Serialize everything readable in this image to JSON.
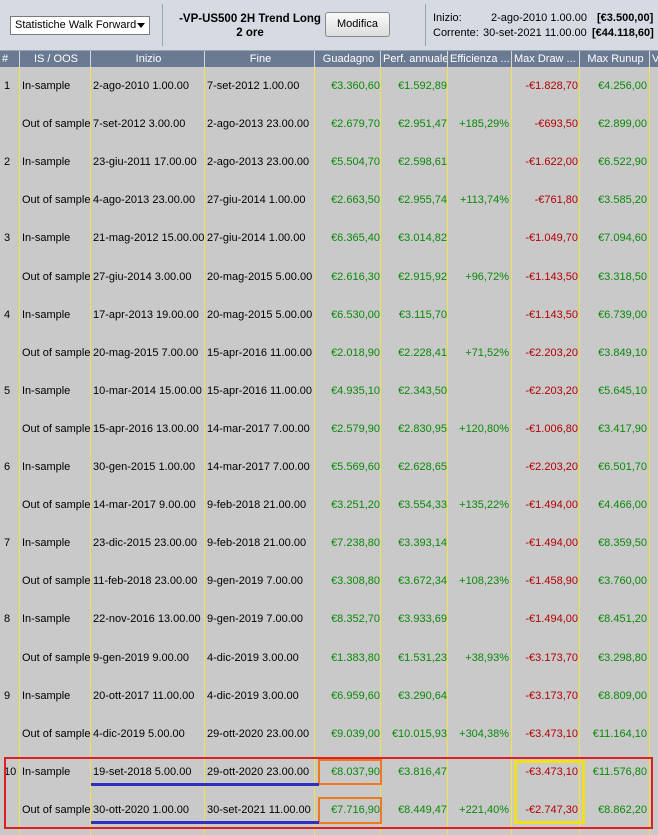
{
  "toolbar": {
    "select_value": "Statistiche Walk Forward",
    "strategy_line1": "-VP-US500 2H Trend Long",
    "strategy_line2": "2 ore",
    "modify_label": "Modifica",
    "start_label": "Inizio:",
    "start_date": "2-ago-2010 1.00.00",
    "start_value": "[€3.500,00]",
    "current_label": "Corrente:",
    "current_date": "30-set-2021 11.00.00",
    "current_value": "[€44.118,60]"
  },
  "columns": [
    "#",
    "IS / OOS",
    "Inizio",
    "Fine",
    "Guadagno",
    "Perf. annuale",
    "Efficienza ...",
    "Max Draw ...",
    "Max Runup",
    "V"
  ],
  "rows": [
    {
      "num": "1",
      "type": "In-sample",
      "start": "2-ago-2010 1.00.00",
      "end": "7-set-2012 1.00.00",
      "gain": "€3.360,60",
      "perf": "€1.592,89",
      "eff": "",
      "dd": "-€1.828,70",
      "runup": "€4.256,00"
    },
    {
      "num": "",
      "type": "Out of sample",
      "start": "7-set-2012 3.00.00",
      "end": "2-ago-2013 23.00.00",
      "gain": "€2.679,70",
      "perf": "€2.951,47",
      "eff": "+185,29%",
      "dd": "-€693,50",
      "runup": "€2.899,00"
    },
    {
      "num": "2",
      "type": "In-sample",
      "start": "23-giu-2011 17.00.00",
      "end": "2-ago-2013 23.00.00",
      "gain": "€5.504,70",
      "perf": "€2.598,61",
      "eff": "",
      "dd": "-€1.622,00",
      "runup": "€6.522,90"
    },
    {
      "num": "",
      "type": "Out of sample",
      "start": "4-ago-2013 23.00.00",
      "end": "27-giu-2014 1.00.00",
      "gain": "€2.663,50",
      "perf": "€2.955,74",
      "eff": "+113,74%",
      "dd": "-€761,80",
      "runup": "€3.585,20"
    },
    {
      "num": "3",
      "type": "In-sample",
      "start": "21-mag-2012 15.00.00",
      "end": "27-giu-2014 1.00.00",
      "gain": "€6.365,40",
      "perf": "€3.014,82",
      "eff": "",
      "dd": "-€1.049,70",
      "runup": "€7.094,60"
    },
    {
      "num": "",
      "type": "Out of sample",
      "start": "27-giu-2014 3.00.00",
      "end": "20-mag-2015 5.00.00",
      "gain": "€2.616,30",
      "perf": "€2.915,92",
      "eff": "+96,72%",
      "dd": "-€1.143,50",
      "runup": "€3.318,50"
    },
    {
      "num": "4",
      "type": "In-sample",
      "start": "17-apr-2013 19.00.00",
      "end": "20-mag-2015 5.00.00",
      "gain": "€6.530,00",
      "perf": "€3.115,70",
      "eff": "",
      "dd": "-€1.143,50",
      "runup": "€6.739,00"
    },
    {
      "num": "",
      "type": "Out of sample",
      "start": "20-mag-2015 7.00.00",
      "end": "15-apr-2016 11.00.00",
      "gain": "€2.018,90",
      "perf": "€2.228,41",
      "eff": "+71,52%",
      "dd": "-€2.203,20",
      "runup": "€3.849,10"
    },
    {
      "num": "5",
      "type": "In-sample",
      "start": "10-mar-2014 15.00.00",
      "end": "15-apr-2016 11.00.00",
      "gain": "€4.935,10",
      "perf": "€2.343,50",
      "eff": "",
      "dd": "-€2.203,20",
      "runup": "€5.645,10"
    },
    {
      "num": "",
      "type": "Out of sample",
      "start": "15-apr-2016 13.00.00",
      "end": "14-mar-2017 7.00.00",
      "gain": "€2.579,90",
      "perf": "€2.830,95",
      "eff": "+120,80%",
      "dd": "-€1.006,80",
      "runup": "€3.417,90"
    },
    {
      "num": "6",
      "type": "In-sample",
      "start": "30-gen-2015 1.00.00",
      "end": "14-mar-2017 7.00.00",
      "gain": "€5.569,60",
      "perf": "€2.628,65",
      "eff": "",
      "dd": "-€2.203,20",
      "runup": "€6.501,70"
    },
    {
      "num": "",
      "type": "Out of sample",
      "start": "14-mar-2017 9.00.00",
      "end": "9-feb-2018 21.00.00",
      "gain": "€3.251,20",
      "perf": "€3.554,33",
      "eff": "+135,22%",
      "dd": "-€1.494,00",
      "runup": "€4.466,00"
    },
    {
      "num": "7",
      "type": "In-sample",
      "start": "23-dic-2015 23.00.00",
      "end": "9-feb-2018 21.00.00",
      "gain": "€7.238,80",
      "perf": "€3.393,14",
      "eff": "",
      "dd": "-€1.494,00",
      "runup": "€8.359,50"
    },
    {
      "num": "",
      "type": "Out of sample",
      "start": "11-feb-2018 23.00.00",
      "end": "9-gen-2019 7.00.00",
      "gain": "€3.308,80",
      "perf": "€3.672,34",
      "eff": "+108,23%",
      "dd": "-€1.458,90",
      "runup": "€3.760,00"
    },
    {
      "num": "8",
      "type": "In-sample",
      "start": "22-nov-2016 13.00.00",
      "end": "9-gen-2019 7.00.00",
      "gain": "€8.352,70",
      "perf": "€3.933,69",
      "eff": "",
      "dd": "-€1.494,00",
      "runup": "€8.451,20"
    },
    {
      "num": "",
      "type": "Out of sample",
      "start": "9-gen-2019 9.00.00",
      "end": "4-dic-2019 3.00.00",
      "gain": "€1.383,80",
      "perf": "€1.531,23",
      "eff": "+38,93%",
      "dd": "-€3.173,70",
      "runup": "€3.298,80"
    },
    {
      "num": "9",
      "type": "In-sample",
      "start": "20-ott-2017 11.00.00",
      "end": "4-dic-2019 3.00.00",
      "gain": "€6.959,60",
      "perf": "€3.290,64",
      "eff": "",
      "dd": "-€3.173,70",
      "runup": "€8.809,00"
    },
    {
      "num": "",
      "type": "Out of sample",
      "start": "4-dic-2019 5.00.00",
      "end": "29-ott-2020 23.00.00",
      "gain": "€9.039,00",
      "perf": "€10.015,93",
      "eff": "+304,38%",
      "dd": "-€3.473,10",
      "runup": "€11.164,10"
    },
    {
      "num": "10",
      "type": "In-sample",
      "start": "19-set-2018 5.00.00",
      "end": "29-ott-2020 23.00.00",
      "gain": "€8.037,90",
      "perf": "€3.816,47",
      "eff": "",
      "dd": "-€3.473,10",
      "runup": "€11.576,80"
    },
    {
      "num": "",
      "type": "Out of sample",
      "start": "30-ott-2020 1.00.00",
      "end": "30-set-2021 11.00.00",
      "gain": "€7.716,90",
      "perf": "€8.449,47",
      "eff": "+221,40%",
      "dd": "-€2.747,30",
      "runup": "€8.862,20"
    }
  ],
  "highlight_colors": {
    "row_box": "#e02020",
    "gain_box": "#f07820",
    "dd_box": "#f0e020",
    "underline": "#3030c0"
  }
}
